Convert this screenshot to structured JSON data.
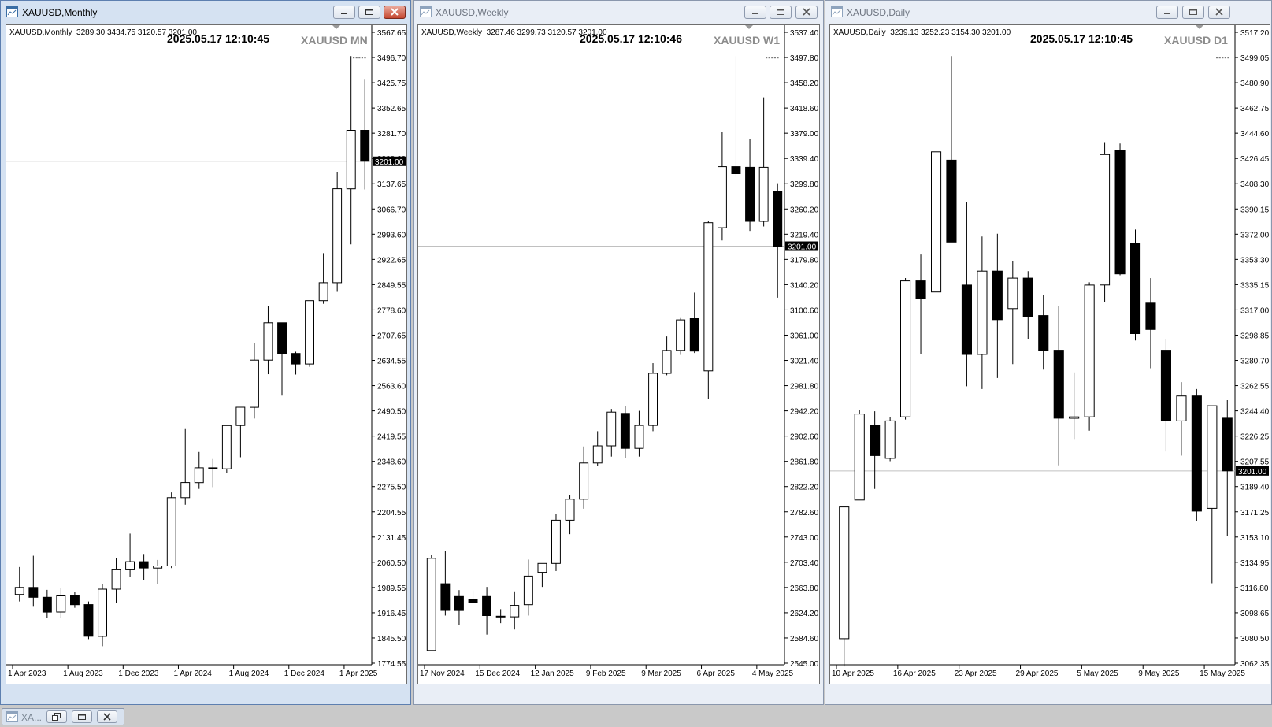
{
  "windows": [
    {
      "id": "monthly",
      "title": "XAUUSD,Monthly",
      "info": "XAUUSD,Monthly  3289.30 3434.75 3120.57 3201.00",
      "timestamp": "2025.05.17 12:10:45",
      "symbol_label": "XAUUSD MN",
      "price_line": 3201.0,
      "price_line_label": "3201.00",
      "price_min": 1774.55,
      "price_max": 3567.65,
      "y_ticks": [
        "3567.65",
        "3496.70",
        "3425.75",
        "3352.65",
        "3281.70",
        "3208.60",
        "3137.65",
        "3066.70",
        "2993.60",
        "2922.65",
        "2849.55",
        "2778.60",
        "2707.65",
        "2634.55",
        "2563.60",
        "2490.50",
        "2419.55",
        "2348.60",
        "2275.50",
        "2204.55",
        "2131.45",
        "2060.50",
        "1989.55",
        "1916.45",
        "1845.50",
        "1774.55"
      ],
      "x_labels": [
        {
          "i": 0,
          "text": "1 Apr 2023"
        },
        {
          "i": 4,
          "text": "1 Aug 2023"
        },
        {
          "i": 8,
          "text": "1 Dec 2023"
        },
        {
          "i": 12,
          "text": "1 Apr 2024"
        },
        {
          "i": 16,
          "text": "1 Aug 2024"
        },
        {
          "i": 20,
          "text": "1 Dec 2024"
        },
        {
          "i": 24,
          "text": "1 Apr 2025"
        }
      ],
      "candles": [
        {
          "o": 1970,
          "h": 2048,
          "l": 1950,
          "c": 1990
        },
        {
          "o": 1990,
          "h": 2080,
          "l": 1935,
          "c": 1962
        },
        {
          "o": 1962,
          "h": 1983,
          "l": 1904,
          "c": 1920
        },
        {
          "o": 1920,
          "h": 1988,
          "l": 1903,
          "c": 1966
        },
        {
          "o": 1966,
          "h": 1977,
          "l": 1932,
          "c": 1941
        },
        {
          "o": 1941,
          "h": 1950,
          "l": 1843,
          "c": 1851
        },
        {
          "o": 1851,
          "h": 2000,
          "l": 1823,
          "c": 1985
        },
        {
          "o": 1985,
          "h": 2073,
          "l": 1945,
          "c": 2040
        },
        {
          "o": 2040,
          "h": 2143,
          "l": 2019,
          "c": 2063
        },
        {
          "o": 2063,
          "h": 2085,
          "l": 2010,
          "c": 2045
        },
        {
          "o": 2045,
          "h": 2068,
          "l": 2000,
          "c": 2051
        },
        {
          "o": 2051,
          "h": 2260,
          "l": 2045,
          "c": 2245
        },
        {
          "o": 2245,
          "h": 2440,
          "l": 2225,
          "c": 2288
        },
        {
          "o": 2288,
          "h": 2375,
          "l": 2270,
          "c": 2330
        },
        {
          "o": 2330,
          "h": 2355,
          "l": 2275,
          "c": 2327
        },
        {
          "o": 2327,
          "h": 2430,
          "l": 2315,
          "c": 2450
        },
        {
          "o": 2450,
          "h": 2480,
          "l": 2360,
          "c": 2502
        },
        {
          "o": 2502,
          "h": 2685,
          "l": 2470,
          "c": 2636
        },
        {
          "o": 2636,
          "h": 2790,
          "l": 2596,
          "c": 2742
        },
        {
          "o": 2742,
          "h": 2720,
          "l": 2535,
          "c": 2655
        },
        {
          "o": 2655,
          "h": 2660,
          "l": 2595,
          "c": 2625
        },
        {
          "o": 2625,
          "h": 2795,
          "l": 2617,
          "c": 2805
        },
        {
          "o": 2805,
          "h": 2940,
          "l": 2796,
          "c": 2856
        },
        {
          "o": 2856,
          "h": 3170,
          "l": 2830,
          "c": 3123
        },
        {
          "o": 3123,
          "h": 3500,
          "l": 2965,
          "c": 3289
        },
        {
          "o": 3289,
          "h": 3435,
          "l": 3121,
          "c": 3201
        }
      ]
    },
    {
      "id": "weekly",
      "title": "XAUUSD,Weekly",
      "info": "XAUUSD,Weekly  3287.46 3299.73 3120.57 3201.00",
      "timestamp": "2025.05.17 12:10:46",
      "symbol_label": "XAUUSD W1",
      "price_line": 3201.0,
      "price_line_label": "3201.00",
      "price_min": 2545.0,
      "price_max": 3537.4,
      "y_ticks": [
        "3537.40",
        "3497.80",
        "3458.20",
        "3418.60",
        "3379.00",
        "3339.40",
        "3299.80",
        "3260.20",
        "3219.40",
        "3179.80",
        "3140.20",
        "3100.60",
        "3061.00",
        "3021.40",
        "2981.80",
        "2942.20",
        "2902.60",
        "2861.80",
        "2822.20",
        "2782.60",
        "2743.00",
        "2703.40",
        "2663.80",
        "2624.20",
        "2584.60",
        "2545.00"
      ],
      "x_labels": [
        {
          "i": 0,
          "text": "17 Nov 2024"
        },
        {
          "i": 4,
          "text": "15 Dec 2024"
        },
        {
          "i": 8,
          "text": "12 Jan 2025"
        },
        {
          "i": 12,
          "text": "9 Feb 2025"
        },
        {
          "i": 16,
          "text": "9 Mar 2025"
        },
        {
          "i": 20,
          "text": "6 Apr 2025"
        },
        {
          "i": 24,
          "text": "4 May 2025"
        }
      ],
      "candles": [
        {
          "o": 2565,
          "h": 2715,
          "l": 2565,
          "c": 2710
        },
        {
          "o": 2670,
          "h": 2722,
          "l": 2620,
          "c": 2628
        },
        {
          "o": 2650,
          "h": 2660,
          "l": 2605,
          "c": 2628
        },
        {
          "o": 2645,
          "h": 2660,
          "l": 2640,
          "c": 2640
        },
        {
          "o": 2650,
          "h": 2665,
          "l": 2590,
          "c": 2620
        },
        {
          "o": 2618,
          "h": 2630,
          "l": 2608,
          "c": 2619
        },
        {
          "o": 2618,
          "h": 2658,
          "l": 2598,
          "c": 2636
        },
        {
          "o": 2637,
          "h": 2708,
          "l": 2620,
          "c": 2682
        },
        {
          "o": 2688,
          "h": 2702,
          "l": 2665,
          "c": 2702
        },
        {
          "o": 2702,
          "h": 2780,
          "l": 2690,
          "c": 2770
        },
        {
          "o": 2770,
          "h": 2810,
          "l": 2748,
          "c": 2803
        },
        {
          "o": 2803,
          "h": 2886,
          "l": 2788,
          "c": 2860
        },
        {
          "o": 2860,
          "h": 2910,
          "l": 2855,
          "c": 2887
        },
        {
          "o": 2887,
          "h": 2945,
          "l": 2870,
          "c": 2940
        },
        {
          "o": 2938,
          "h": 2950,
          "l": 2868,
          "c": 2883
        },
        {
          "o": 2883,
          "h": 2942,
          "l": 2870,
          "c": 2919
        },
        {
          "o": 2919,
          "h": 3017,
          "l": 2910,
          "c": 3001
        },
        {
          "o": 3001,
          "h": 3059,
          "l": 2998,
          "c": 3037
        },
        {
          "o": 3037,
          "h": 3088,
          "l": 3030,
          "c": 3085
        },
        {
          "o": 3087,
          "h": 3128,
          "l": 3033,
          "c": 3036
        },
        {
          "o": 3005,
          "h": 3240,
          "l": 2960,
          "c": 3238
        },
        {
          "o": 3230,
          "h": 3380,
          "l": 3210,
          "c": 3326
        },
        {
          "o": 3326,
          "h": 3500,
          "l": 3310,
          "c": 3315
        },
        {
          "o": 3325,
          "h": 3370,
          "l": 3225,
          "c": 3240
        },
        {
          "o": 3240,
          "h": 3435,
          "l": 3232,
          "c": 3325
        },
        {
          "o": 3287,
          "h": 3300,
          "l": 3120,
          "c": 3201
        }
      ]
    },
    {
      "id": "daily",
      "title": "XAUUSD,Daily",
      "info": "XAUUSD,Daily  3239.13 3252.23 3154.30 3201.00",
      "timestamp": "2025.05.17 12:10:45",
      "symbol_label": "XAUUSD D1",
      "price_line": 3201.0,
      "price_line_label": "3201.00",
      "price_min": 3062.35,
      "price_max": 3517.2,
      "y_ticks": [
        "3517.20",
        "3499.05",
        "3480.90",
        "3462.75",
        "3444.60",
        "3426.45",
        "3408.30",
        "3390.15",
        "3372.00",
        "3353.30",
        "3335.15",
        "3317.00",
        "3298.85",
        "3280.70",
        "3262.55",
        "3244.40",
        "3226.25",
        "3207.55",
        "3189.40",
        "3171.25",
        "3153.10",
        "3134.95",
        "3116.80",
        "3098.65",
        "3080.50",
        "3062.35"
      ],
      "x_labels": [
        {
          "i": 0,
          "text": "10 Apr 2025"
        },
        {
          "i": 4,
          "text": "16 Apr 2025"
        },
        {
          "i": 8,
          "text": "23 Apr 2025"
        },
        {
          "i": 12,
          "text": "29 Apr 2025"
        },
        {
          "i": 16,
          "text": "5 May 2025"
        },
        {
          "i": 20,
          "text": "9 May 2025"
        },
        {
          "i": 24,
          "text": "15 May 2025"
        }
      ],
      "candles": [
        {
          "o": 3080,
          "h": 3175,
          "l": 3060,
          "c": 3175
        },
        {
          "o": 3180,
          "h": 3245,
          "l": 3180,
          "c": 3242
        },
        {
          "o": 3234,
          "h": 3244,
          "l": 3188,
          "c": 3212
        },
        {
          "o": 3210,
          "h": 3240,
          "l": 3208,
          "c": 3237
        },
        {
          "o": 3240,
          "h": 3340,
          "l": 3238,
          "c": 3338
        },
        {
          "o": 3338,
          "h": 3357,
          "l": 3285,
          "c": 3325
        },
        {
          "o": 3330,
          "h": 3435,
          "l": 3325,
          "c": 3431
        },
        {
          "o": 3425,
          "h": 3500,
          "l": 3368,
          "c": 3366
        },
        {
          "o": 3335,
          "h": 3395,
          "l": 3262,
          "c": 3285
        },
        {
          "o": 3285,
          "h": 3370,
          "l": 3260,
          "c": 3345
        },
        {
          "o": 3345,
          "h": 3372,
          "l": 3268,
          "c": 3310
        },
        {
          "o": 3318,
          "h": 3352,
          "l": 3278,
          "c": 3340
        },
        {
          "o": 3340,
          "h": 3345,
          "l": 3296,
          "c": 3312
        },
        {
          "o": 3313,
          "h": 3328,
          "l": 3274,
          "c": 3288
        },
        {
          "o": 3288,
          "h": 3320,
          "l": 3205,
          "c": 3239
        },
        {
          "o": 3239,
          "h": 3272,
          "l": 3224,
          "c": 3240
        },
        {
          "o": 3240,
          "h": 3337,
          "l": 3230,
          "c": 3335
        },
        {
          "o": 3335,
          "h": 3438,
          "l": 3323,
          "c": 3429
        },
        {
          "o": 3432,
          "h": 3437,
          "l": 3342,
          "c": 3343
        },
        {
          "o": 3365,
          "h": 3375,
          "l": 3295,
          "c": 3300
        },
        {
          "o": 3322,
          "h": 3340,
          "l": 3275,
          "c": 3303
        },
        {
          "o": 3288,
          "h": 3296,
          "l": 3215,
          "c": 3237
        },
        {
          "o": 3237,
          "h": 3265,
          "l": 3212,
          "c": 3255
        },
        {
          "o": 3255,
          "h": 3260,
          "l": 3165,
          "c": 3172
        },
        {
          "o": 3174,
          "h": 3246,
          "l": 3120,
          "c": 3248
        },
        {
          "o": 3239,
          "h": 3252,
          "l": 3154,
          "c": 3201
        }
      ]
    }
  ],
  "taskbar": {
    "minimized_title": "XA..."
  },
  "colors": {
    "bull": "#ffffff",
    "bear": "#000000",
    "wick": "#000000",
    "grid": "#c0c0c0",
    "label_bg": "#000000"
  }
}
